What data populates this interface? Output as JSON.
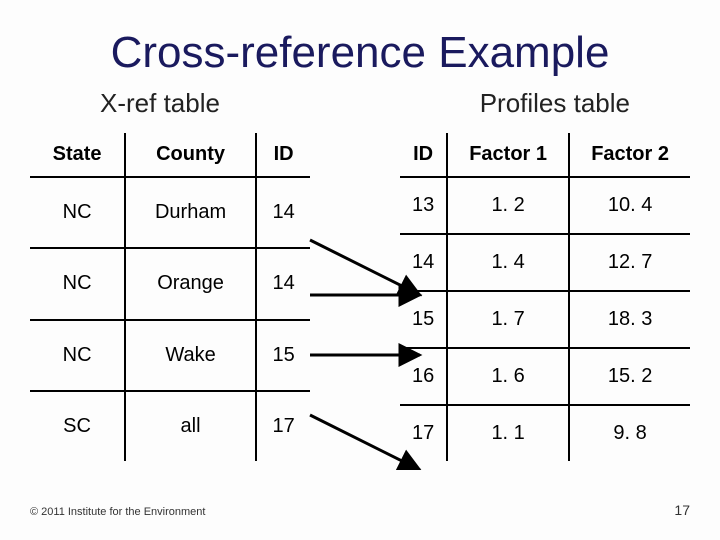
{
  "title": "Cross-reference Example",
  "subtitle_left": "X-ref table",
  "subtitle_right": "Profiles table",
  "xref": {
    "headers": [
      "State",
      "County",
      "ID"
    ],
    "rows": [
      [
        "NC",
        "Durham",
        "14"
      ],
      [
        "NC",
        "Orange",
        "14"
      ],
      [
        "NC",
        "Wake",
        "15"
      ],
      [
        "SC",
        "all",
        "17"
      ]
    ]
  },
  "profiles": {
    "headers": [
      "ID",
      "Factor 1",
      "Factor 2"
    ],
    "rows": [
      [
        "13",
        "1. 2",
        "10. 4"
      ],
      [
        "14",
        "1. 4",
        "12. 7"
      ],
      [
        "15",
        "1. 7",
        "18. 3"
      ],
      [
        "16",
        "1. 6",
        "15. 2"
      ],
      [
        "17",
        "1. 1",
        "9. 8"
      ]
    ]
  },
  "footer": "© 2011 Institute for the Environment",
  "pagenum": "17"
}
